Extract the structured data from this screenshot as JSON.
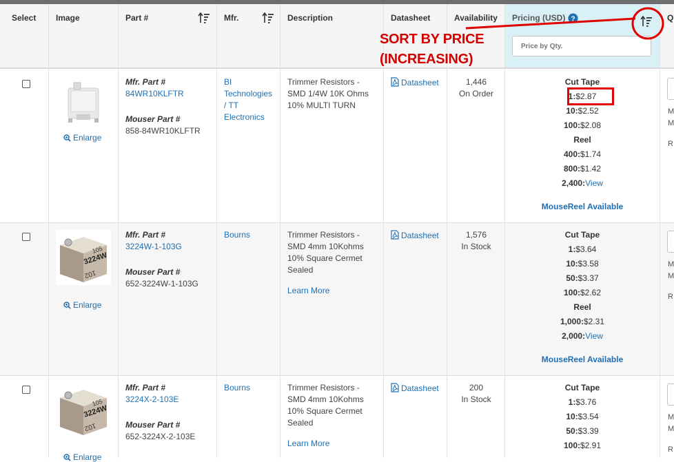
{
  "columns": {
    "select": "Select",
    "image": "Image",
    "part": "Part #",
    "mfr": "Mfr.",
    "description": "Description",
    "datasheet": "Datasheet",
    "availability": "Availability",
    "pricing": "Pricing (USD)",
    "qty_cut": "Q"
  },
  "pricing_filter": {
    "placeholder": "Price by Qty."
  },
  "annotation": {
    "line1": "SORT BY PRICE",
    "line2": "(INCREASING)"
  },
  "labels": {
    "mfr_part": "Mfr. Part #",
    "mouser_part": "Mouser Part #",
    "enlarge": "Enlarge",
    "datasheet": "Datasheet",
    "learn_more": "Learn More",
    "mousereel": "MouseReel Available",
    "view": "View",
    "cut_tape": "Cut Tape",
    "reel": "Reel"
  },
  "rows": [
    {
      "mfr_part": "84WR10KLFTR",
      "mouser_part": "858-84WR10KLFTR",
      "mfr_lines": [
        "BI",
        "Technologies",
        "/ TT",
        "Electronics"
      ],
      "description_lines": [
        "Trimmer Resistors -",
        "SMD 1/4W 10K Ohms",
        "10% MULTI TURN"
      ],
      "availability_qty": "1,446",
      "availability_status": "On Order",
      "cut_tape": [
        [
          "1:",
          "$2.87"
        ],
        [
          "10:",
          "$2.52"
        ],
        [
          "100:",
          "$2.08"
        ]
      ],
      "reel": [
        [
          "400:",
          "$1.74"
        ],
        [
          "800:",
          "$1.42"
        ],
        [
          "2,400:",
          "View"
        ]
      ]
    },
    {
      "mfr_part": "3224W-1-103G",
      "mouser_part": "652-3224W-1-103G",
      "mfr_lines": [
        "Bourns"
      ],
      "description_lines": [
        "Trimmer Resistors -",
        "SMD 4mm 10Kohms",
        "10% Square Cermet",
        "Sealed"
      ],
      "availability_qty": "1,576",
      "availability_status": "In Stock",
      "cut_tape": [
        [
          "1:",
          "$3.64"
        ],
        [
          "10:",
          "$3.58"
        ],
        [
          "50:",
          "$3.37"
        ],
        [
          "100:",
          "$2.62"
        ]
      ],
      "reel": [
        [
          "1,000:",
          "$2.31"
        ],
        [
          "2,000:",
          "View"
        ]
      ],
      "image_text": [
        "105",
        "3224W",
        "102"
      ]
    },
    {
      "mfr_part": "3224X-2-103E",
      "mouser_part": "652-3224X-2-103E",
      "mfr_lines": [
        "Bourns"
      ],
      "description_lines": [
        "Trimmer Resistors -",
        "SMD 4mm 10Kohms",
        "10% Square Cermet",
        "Sealed"
      ],
      "availability_qty": "200",
      "availability_status": "In Stock",
      "cut_tape": [
        [
          "1:",
          "$3.76"
        ],
        [
          "10:",
          "$3.54"
        ],
        [
          "50:",
          "$3.39"
        ],
        [
          "100:",
          "$2.91"
        ]
      ],
      "image_text": [
        "105",
        "3224W",
        "102"
      ]
    }
  ],
  "right_edge": {
    "m": "M",
    "r": "R"
  },
  "colors": {
    "link": "#1f6fb2",
    "pricing_header": "#d9f1f6",
    "annotation": "#d40000"
  }
}
